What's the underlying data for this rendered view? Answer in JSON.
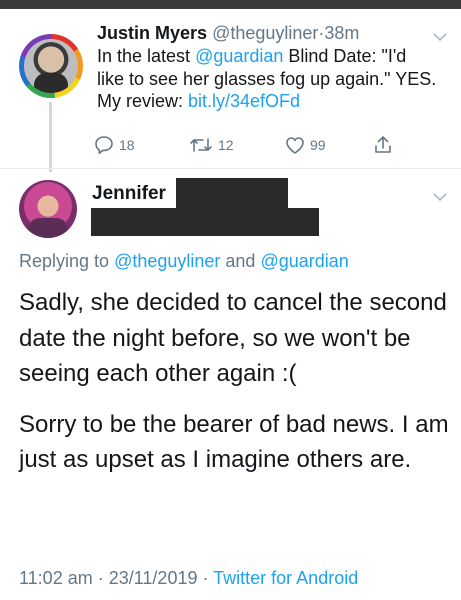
{
  "tweet1": {
    "name": "Justin Myers",
    "handle": "@theguyliner",
    "separator": "·",
    "time": "38m",
    "body_pre": "In the latest ",
    "mention": "@guardian",
    "body_mid": " Blind Date: \"I'd like to see her glasses fog up again.\" YES. My review: ",
    "link": "bit.ly/34efOFd",
    "replies": "18",
    "retweets": "12",
    "likes": "99"
  },
  "tweet2": {
    "name": "Jennifer",
    "replying_prefix": "Replying to ",
    "replying_to_1": "@theguyliner",
    "replying_and": " and ",
    "replying_to_2": "@guardian",
    "paragraph_1": "Sadly, she decided to cancel the second date the night before, so we won't be seeing each other again :(",
    "paragraph_2": "Sorry to be the bearer of bad news. I am just as upset as I imagine others are.",
    "time": "11:02 am",
    "sep1": " · ",
    "date": "23/11/2019",
    "sep2": " · ",
    "source": "Twitter for Android"
  },
  "colors": {
    "accent": "#1da1f2",
    "secondary_text": "#657786",
    "redaction": "#2a2a2a"
  },
  "icons": [
    "reply-icon",
    "retweet-icon",
    "like-icon",
    "share-icon",
    "chevron-down-icon"
  ]
}
